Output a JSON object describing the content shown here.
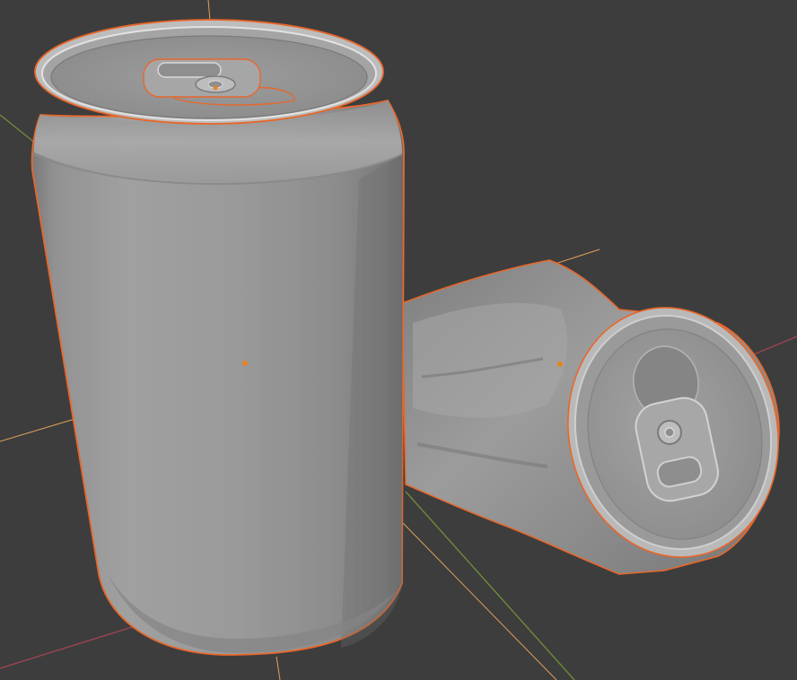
{
  "viewport": {
    "background_color": "#3d3d3d",
    "grid_axis_x_color": "#9a4552",
    "grid_axis_y_color": "#6f8a3a",
    "selection_outline_color": "#e8672a",
    "object_origin_color": "#e8831f",
    "light_axis_color": "#e0a05a"
  },
  "objects": [
    {
      "name": "upright-soda-can",
      "state": "selected"
    },
    {
      "name": "crushed-soda-can",
      "state": "selected"
    }
  ]
}
